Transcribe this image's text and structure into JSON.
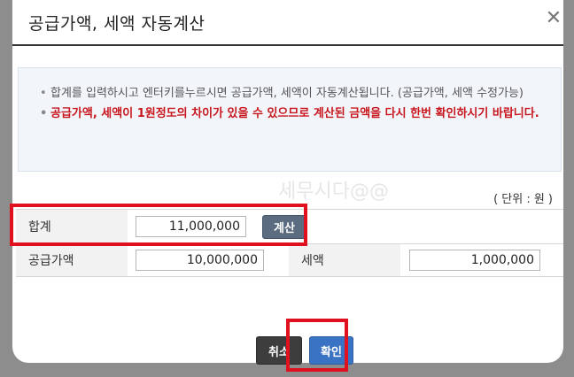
{
  "dialog": {
    "title": "공급가액, 세액 자동계산",
    "close_glyph": "✕"
  },
  "notice": {
    "bullet": "•",
    "line1": "합계를 입력하시고 엔터키를누르시면 공급가액, 세액이 자동계산됩니다. (공급가액, 세액 수정가능)",
    "line2": "공급가액, 세액이 1원정도의 차이가 있을 수 있으므로 계산된 금액을 다시 한번 확인하시기 바랍니다."
  },
  "unit_label": "( 단위 : 원 )",
  "watermark": "세무시다@@",
  "form": {
    "total_label": "합계",
    "total_value": "11,000,000",
    "calc_button": "계산",
    "supply_label": "공급가액",
    "supply_value": "10,000,000",
    "tax_label": "세액",
    "tax_value": "1,000,000"
  },
  "buttons": {
    "cancel": "취소",
    "ok": "확인"
  },
  "colors": {
    "highlight": "#e0101e",
    "notice_red": "#c8161d",
    "ok_blue": "#3b73c4"
  }
}
